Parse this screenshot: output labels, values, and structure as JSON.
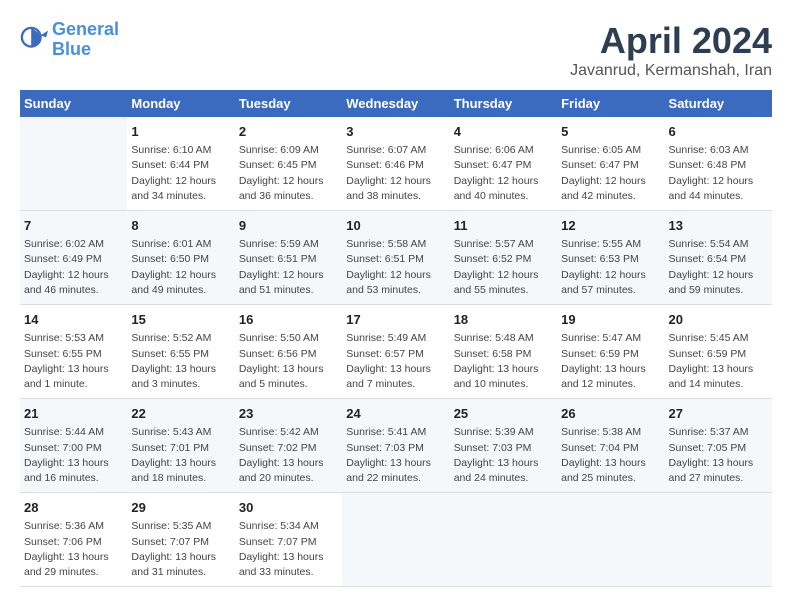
{
  "header": {
    "logo_line1": "General",
    "logo_line2": "Blue",
    "month": "April 2024",
    "location": "Javanrud, Kermanshah, Iran"
  },
  "days_of_week": [
    "Sunday",
    "Monday",
    "Tuesday",
    "Wednesday",
    "Thursday",
    "Friday",
    "Saturday"
  ],
  "weeks": [
    [
      {
        "day": "",
        "info": ""
      },
      {
        "day": "1",
        "info": "Sunrise: 6:10 AM\nSunset: 6:44 PM\nDaylight: 12 hours\nand 34 minutes."
      },
      {
        "day": "2",
        "info": "Sunrise: 6:09 AM\nSunset: 6:45 PM\nDaylight: 12 hours\nand 36 minutes."
      },
      {
        "day": "3",
        "info": "Sunrise: 6:07 AM\nSunset: 6:46 PM\nDaylight: 12 hours\nand 38 minutes."
      },
      {
        "day": "4",
        "info": "Sunrise: 6:06 AM\nSunset: 6:47 PM\nDaylight: 12 hours\nand 40 minutes."
      },
      {
        "day": "5",
        "info": "Sunrise: 6:05 AM\nSunset: 6:47 PM\nDaylight: 12 hours\nand 42 minutes."
      },
      {
        "day": "6",
        "info": "Sunrise: 6:03 AM\nSunset: 6:48 PM\nDaylight: 12 hours\nand 44 minutes."
      }
    ],
    [
      {
        "day": "7",
        "info": "Sunrise: 6:02 AM\nSunset: 6:49 PM\nDaylight: 12 hours\nand 46 minutes."
      },
      {
        "day": "8",
        "info": "Sunrise: 6:01 AM\nSunset: 6:50 PM\nDaylight: 12 hours\nand 49 minutes."
      },
      {
        "day": "9",
        "info": "Sunrise: 5:59 AM\nSunset: 6:51 PM\nDaylight: 12 hours\nand 51 minutes."
      },
      {
        "day": "10",
        "info": "Sunrise: 5:58 AM\nSunset: 6:51 PM\nDaylight: 12 hours\nand 53 minutes."
      },
      {
        "day": "11",
        "info": "Sunrise: 5:57 AM\nSunset: 6:52 PM\nDaylight: 12 hours\nand 55 minutes."
      },
      {
        "day": "12",
        "info": "Sunrise: 5:55 AM\nSunset: 6:53 PM\nDaylight: 12 hours\nand 57 minutes."
      },
      {
        "day": "13",
        "info": "Sunrise: 5:54 AM\nSunset: 6:54 PM\nDaylight: 12 hours\nand 59 minutes."
      }
    ],
    [
      {
        "day": "14",
        "info": "Sunrise: 5:53 AM\nSunset: 6:55 PM\nDaylight: 13 hours\nand 1 minute."
      },
      {
        "day": "15",
        "info": "Sunrise: 5:52 AM\nSunset: 6:55 PM\nDaylight: 13 hours\nand 3 minutes."
      },
      {
        "day": "16",
        "info": "Sunrise: 5:50 AM\nSunset: 6:56 PM\nDaylight: 13 hours\nand 5 minutes."
      },
      {
        "day": "17",
        "info": "Sunrise: 5:49 AM\nSunset: 6:57 PM\nDaylight: 13 hours\nand 7 minutes."
      },
      {
        "day": "18",
        "info": "Sunrise: 5:48 AM\nSunset: 6:58 PM\nDaylight: 13 hours\nand 10 minutes."
      },
      {
        "day": "19",
        "info": "Sunrise: 5:47 AM\nSunset: 6:59 PM\nDaylight: 13 hours\nand 12 minutes."
      },
      {
        "day": "20",
        "info": "Sunrise: 5:45 AM\nSunset: 6:59 PM\nDaylight: 13 hours\nand 14 minutes."
      }
    ],
    [
      {
        "day": "21",
        "info": "Sunrise: 5:44 AM\nSunset: 7:00 PM\nDaylight: 13 hours\nand 16 minutes."
      },
      {
        "day": "22",
        "info": "Sunrise: 5:43 AM\nSunset: 7:01 PM\nDaylight: 13 hours\nand 18 minutes."
      },
      {
        "day": "23",
        "info": "Sunrise: 5:42 AM\nSunset: 7:02 PM\nDaylight: 13 hours\nand 20 minutes."
      },
      {
        "day": "24",
        "info": "Sunrise: 5:41 AM\nSunset: 7:03 PM\nDaylight: 13 hours\nand 22 minutes."
      },
      {
        "day": "25",
        "info": "Sunrise: 5:39 AM\nSunset: 7:03 PM\nDaylight: 13 hours\nand 24 minutes."
      },
      {
        "day": "26",
        "info": "Sunrise: 5:38 AM\nSunset: 7:04 PM\nDaylight: 13 hours\nand 25 minutes."
      },
      {
        "day": "27",
        "info": "Sunrise: 5:37 AM\nSunset: 7:05 PM\nDaylight: 13 hours\nand 27 minutes."
      }
    ],
    [
      {
        "day": "28",
        "info": "Sunrise: 5:36 AM\nSunset: 7:06 PM\nDaylight: 13 hours\nand 29 minutes."
      },
      {
        "day": "29",
        "info": "Sunrise: 5:35 AM\nSunset: 7:07 PM\nDaylight: 13 hours\nand 31 minutes."
      },
      {
        "day": "30",
        "info": "Sunrise: 5:34 AM\nSunset: 7:07 PM\nDaylight: 13 hours\nand 33 minutes."
      },
      {
        "day": "",
        "info": ""
      },
      {
        "day": "",
        "info": ""
      },
      {
        "day": "",
        "info": ""
      },
      {
        "day": "",
        "info": ""
      }
    ]
  ]
}
